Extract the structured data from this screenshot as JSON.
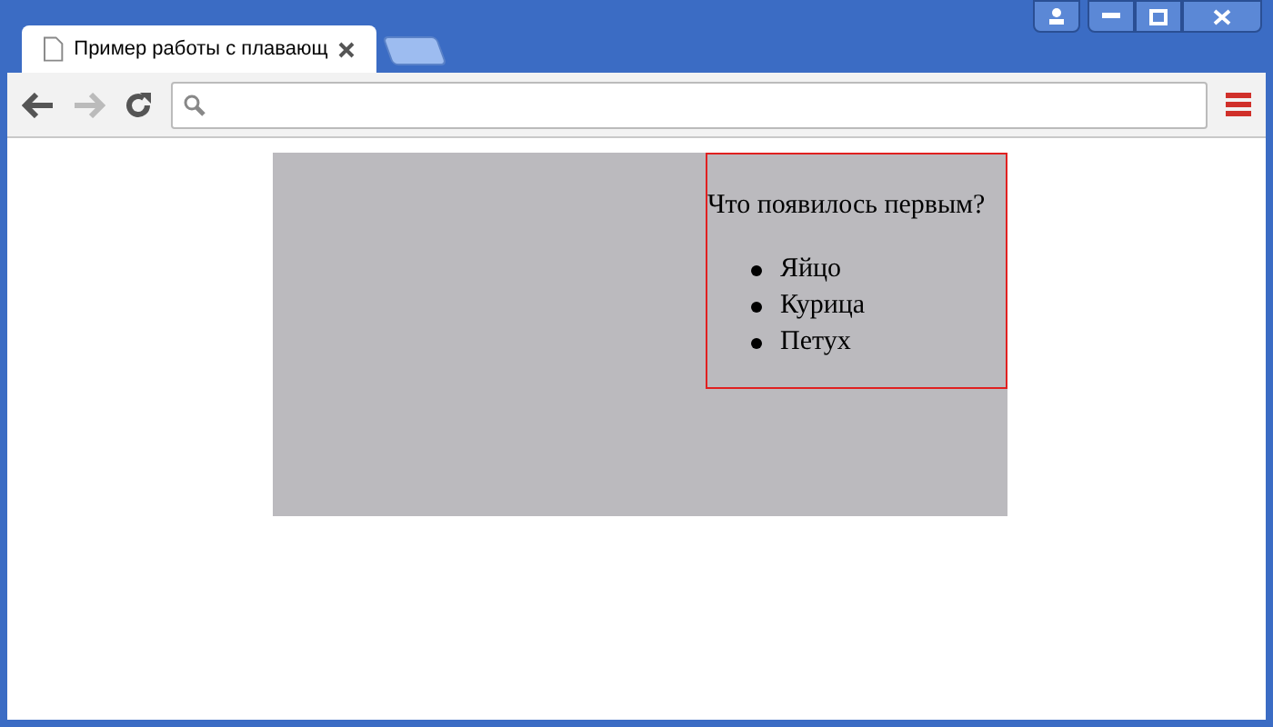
{
  "tabs": [
    {
      "title": "Пример работы с плавающ",
      "selected": true
    }
  ],
  "page": {
    "question": "Что появилось первым?",
    "answers": [
      "Яйцо",
      "Курица",
      "Петух"
    ]
  }
}
